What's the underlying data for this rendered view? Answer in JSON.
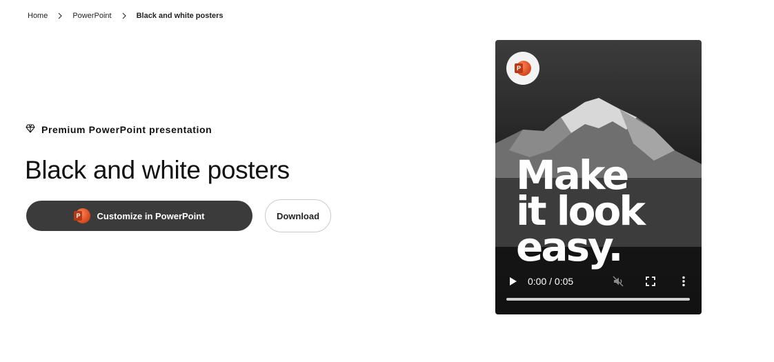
{
  "breadcrumb": {
    "items": [
      "Home",
      "PowerPoint",
      "Black and white posters"
    ]
  },
  "premium": {
    "label": "Premium PowerPoint presentation",
    "icon": "diamond-icon"
  },
  "page_title": "Black and white posters",
  "actions": {
    "customize_label": "Customize in PowerPoint",
    "download_label": "Download"
  },
  "video": {
    "overlay_text": [
      "Make",
      "it look",
      "easy."
    ],
    "time": "0:00 / 0:05",
    "progress": 0,
    "muted": true,
    "icons": [
      "play-icon",
      "mute-icon",
      "fullscreen-icon",
      "more-vertical-icon"
    ]
  },
  "colors": {
    "primary_button": "#3b3b3b",
    "powerpoint_orange": "#d6461c"
  }
}
